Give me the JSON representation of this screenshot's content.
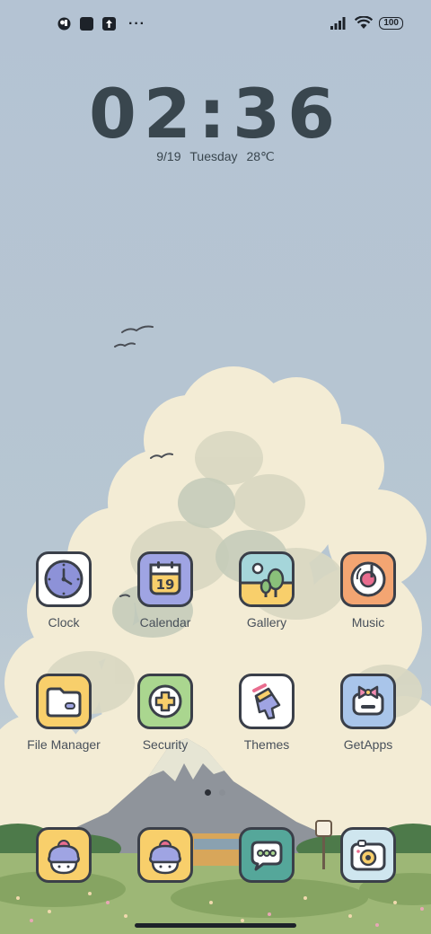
{
  "status_bar": {
    "left_icons": [
      "app-notification-icon",
      "media-notification-icon",
      "upload-notification-icon",
      "more-notifications-icon"
    ],
    "more_glyph": "···",
    "right_icons": [
      "signal-icon",
      "wifi-icon",
      "battery-icon"
    ],
    "battery_level": "100"
  },
  "lockclock": {
    "time": "02:36",
    "date": "9/19",
    "weekday": "Tuesday",
    "temperature": "28℃"
  },
  "apps": [
    {
      "label": "Clock",
      "icon": "clock-icon",
      "color": "#ffffff"
    },
    {
      "label": "Calendar",
      "icon": "calendar-icon",
      "color": "#9fa4e3"
    },
    {
      "label": "Gallery",
      "icon": "gallery-icon",
      "color": "#a5d6da"
    },
    {
      "label": "Music",
      "icon": "music-icon",
      "color": "#f3a572"
    },
    {
      "label": "File Manager",
      "icon": "folder-icon",
      "color": "#f8cf6b"
    },
    {
      "label": "Security",
      "icon": "security-icon",
      "color": "#aad68f"
    },
    {
      "label": "Themes",
      "icon": "themes-icon",
      "color": "#ffffff"
    },
    {
      "label": "GetApps",
      "icon": "getapps-icon",
      "color": "#a9c5ea"
    }
  ],
  "dock": [
    {
      "icon": "phone-face-icon",
      "color": "#f8cf6b"
    },
    {
      "icon": "contacts-face-icon",
      "color": "#f8cf6b"
    },
    {
      "icon": "messages-icon",
      "color": "#55a79a"
    },
    {
      "icon": "camera-icon",
      "color": "#cfe6ef"
    }
  ],
  "calendar_day": "19",
  "page_indicator": {
    "pages": 2,
    "active": 0
  },
  "colors": {
    "sky": "#b3c3d3",
    "cloud": "#f3ecd5",
    "mountain": "#8e939a",
    "grass": "#9db776"
  }
}
